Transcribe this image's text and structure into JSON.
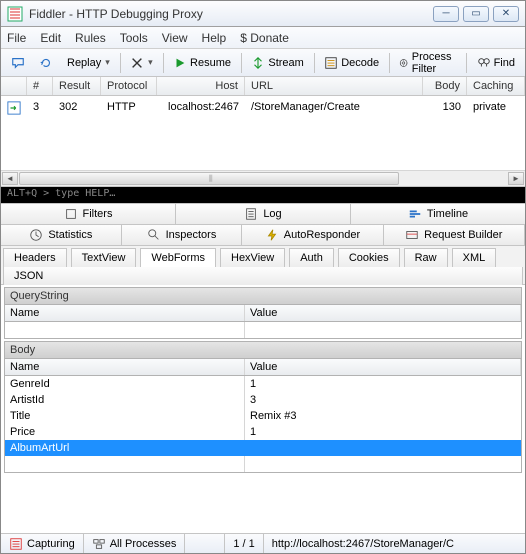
{
  "window": {
    "title": "Fiddler - HTTP Debugging Proxy"
  },
  "menu": {
    "file": "File",
    "edit": "Edit",
    "rules": "Rules",
    "tools": "Tools",
    "view": "View",
    "help": "Help",
    "donate": "$ Donate"
  },
  "toolbar": {
    "replay": "Replay",
    "resume": "Resume",
    "stream": "Stream",
    "decode": "Decode",
    "process_filter": "Process Filter",
    "find": "Find"
  },
  "grid": {
    "cols": {
      "num": "#",
      "result": "Result",
      "protocol": "Protocol",
      "host": "Host",
      "url": "URL",
      "body": "Body",
      "caching": "Caching"
    },
    "rows": [
      {
        "num": "3",
        "result": "302",
        "protocol": "HTTP",
        "host": "localhost:2467",
        "url": "/StoreManager/Create",
        "body": "130",
        "caching": "private"
      }
    ]
  },
  "cmd": {
    "hint": "ALT+Q > type HELP…"
  },
  "upper_tabs": {
    "filters": "Filters",
    "log": "Log",
    "timeline": "Timeline"
  },
  "main_tabs": {
    "statistics": "Statistics",
    "inspectors": "Inspectors",
    "autoresponder": "AutoResponder",
    "request_builder": "Request Builder"
  },
  "sub_tabs": {
    "headers": "Headers",
    "textview": "TextView",
    "webforms": "WebForms",
    "hexview": "HexView",
    "auth": "Auth",
    "cookies": "Cookies",
    "raw": "Raw",
    "xml": "XML",
    "json": "JSON"
  },
  "querystring": {
    "title": "QueryString",
    "name_h": "Name",
    "value_h": "Value"
  },
  "body_section": {
    "title": "Body",
    "name_h": "Name",
    "value_h": "Value",
    "rows": [
      {
        "name": "GenreId",
        "value": "1"
      },
      {
        "name": "ArtistId",
        "value": "3"
      },
      {
        "name": "Title",
        "value": "Remix #3"
      },
      {
        "name": "Price",
        "value": "1"
      },
      {
        "name": "AlbumArtUrl",
        "value": ""
      }
    ]
  },
  "status": {
    "capturing": "Capturing",
    "processes": "All Processes",
    "count": "1 / 1",
    "url": "http://localhost:2467/StoreManager/C"
  }
}
